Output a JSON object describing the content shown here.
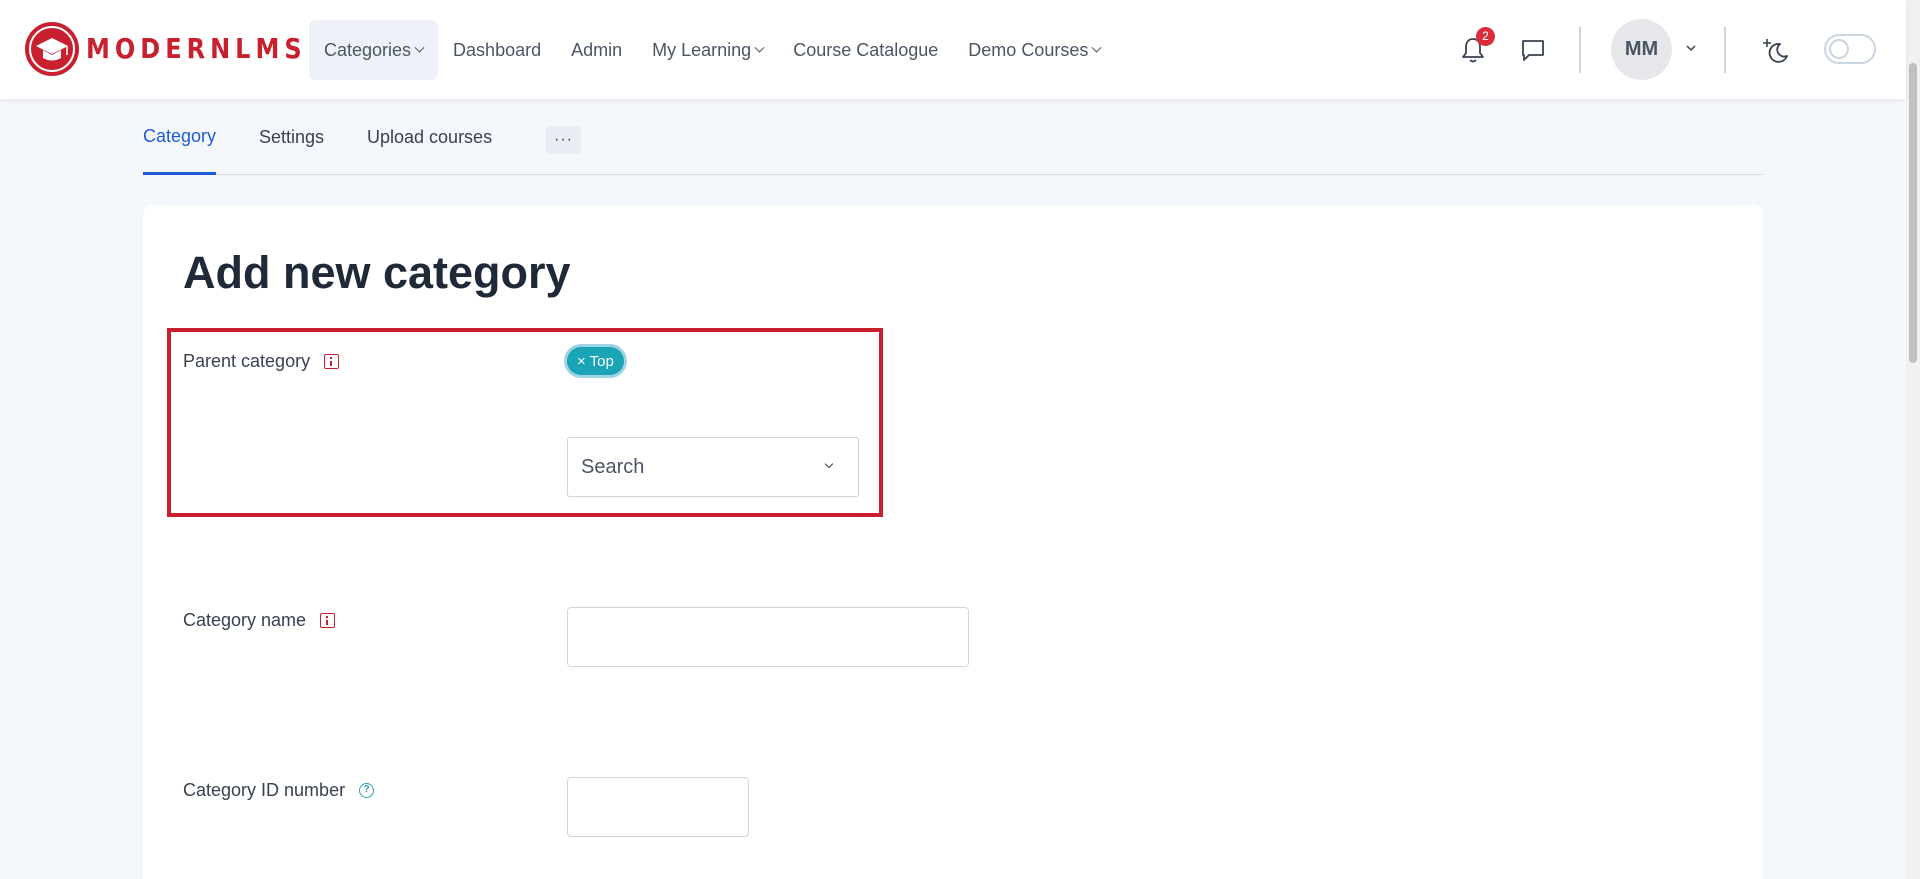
{
  "brand": {
    "name": "MODERNLMS",
    "color": "#c8202e"
  },
  "nav": {
    "items": [
      {
        "label": "Categories",
        "has_caret": true,
        "active": true
      },
      {
        "label": "Dashboard",
        "has_caret": false
      },
      {
        "label": "Admin",
        "has_caret": false
      },
      {
        "label": "My Learning",
        "has_caret": true
      },
      {
        "label": "Course Catalogue",
        "has_caret": false
      },
      {
        "label": "Demo Courses",
        "has_caret": true
      }
    ]
  },
  "header": {
    "notifications_count": "2",
    "avatar_initials": "MM",
    "icons": [
      "bell-icon",
      "chat-icon",
      "moon-sparkle-icon",
      "toggle-switch"
    ]
  },
  "tabs": {
    "items": [
      {
        "label": "Category",
        "active": true
      },
      {
        "label": "Settings"
      },
      {
        "label": "Upload courses"
      }
    ],
    "more_label": "···"
  },
  "form": {
    "title": "Add new category",
    "parent_category": {
      "label": "Parent category",
      "selected_chip": "× Top",
      "search_placeholder": "Search"
    },
    "category_name": {
      "label": "Category name",
      "value": ""
    },
    "category_id_number": {
      "label": "Category ID number",
      "value": ""
    }
  },
  "colors": {
    "accent": "#1e5bd8",
    "chip": "#1ba3b6",
    "highlight": "#c8202e",
    "badge": "#d92d3b"
  }
}
